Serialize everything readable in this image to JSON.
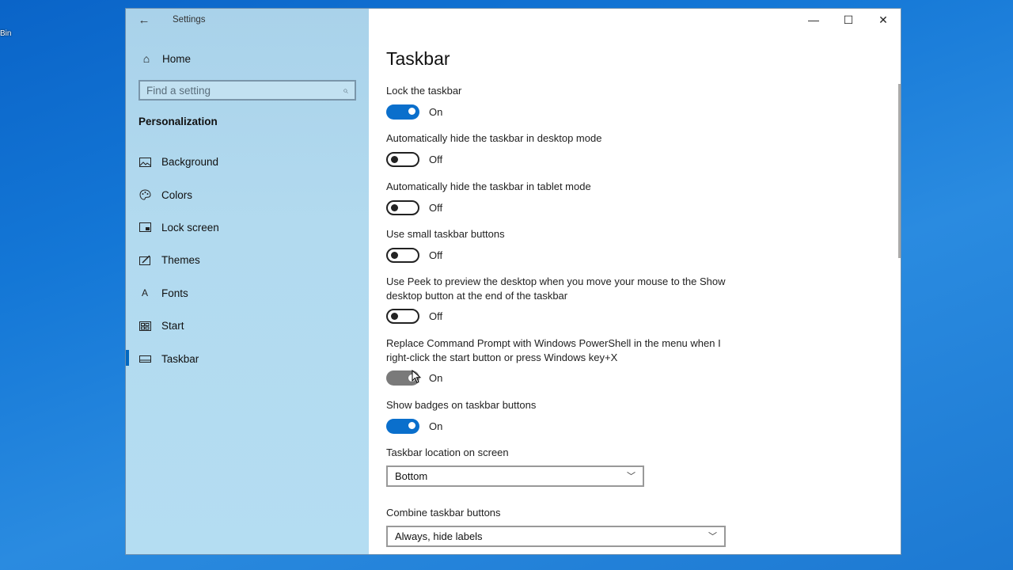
{
  "desktop": {
    "icon_label": "Bin"
  },
  "window": {
    "title": "Settings",
    "controls": {
      "minimize": "—",
      "maximize": "☐",
      "close": "✕"
    }
  },
  "sidebar": {
    "home_label": "Home",
    "search": {
      "placeholder": "Find a setting"
    },
    "section": "Personalization",
    "items": [
      {
        "label": "Background",
        "icon": "picture-icon",
        "active": false
      },
      {
        "label": "Colors",
        "icon": "palette-icon",
        "active": false
      },
      {
        "label": "Lock screen",
        "icon": "lock-screen-icon",
        "active": false
      },
      {
        "label": "Themes",
        "icon": "themes-icon",
        "active": false
      },
      {
        "label": "Fonts",
        "icon": "fonts-icon",
        "active": false
      },
      {
        "label": "Start",
        "icon": "start-icon",
        "active": false
      },
      {
        "label": "Taskbar",
        "icon": "taskbar-icon",
        "active": true
      }
    ]
  },
  "main": {
    "title": "Taskbar",
    "settings": [
      {
        "label": "Lock the taskbar",
        "state": "On"
      },
      {
        "label": "Automatically hide the taskbar in desktop mode",
        "state": "Off"
      },
      {
        "label": "Automatically hide the taskbar in tablet mode",
        "state": "Off"
      },
      {
        "label": "Use small taskbar buttons",
        "state": "Off"
      },
      {
        "label": "Use Peek to preview the desktop when you move your mouse to the Show desktop button at the end of the taskbar",
        "state": "Off"
      },
      {
        "label": "Replace Command Prompt with Windows PowerShell in the menu when I right-click the start button or press Windows key+X",
        "state": "On"
      },
      {
        "label": "Show badges on taskbar buttons",
        "state": "On"
      }
    ],
    "location": {
      "label": "Taskbar location on screen",
      "value": "Bottom"
    },
    "combine": {
      "label": "Combine taskbar buttons",
      "value": "Always, hide labels"
    }
  },
  "colors": {
    "accent": "#0a6fcc",
    "sidebar": "#b2daef"
  }
}
